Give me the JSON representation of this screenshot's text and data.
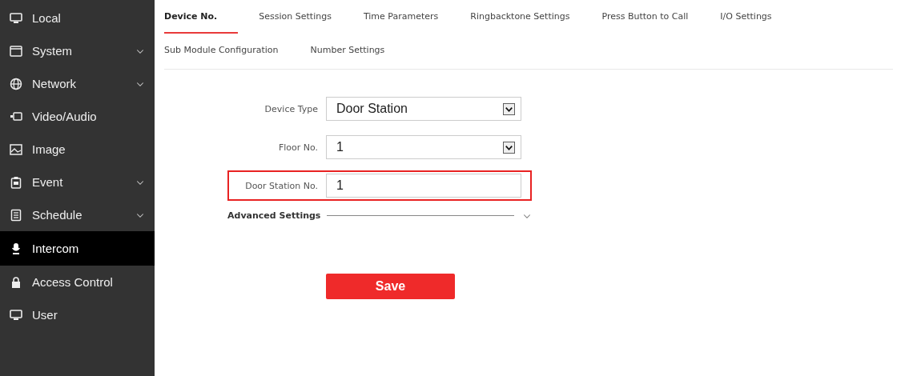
{
  "sidebar": {
    "items": [
      {
        "label": "Local",
        "expandable": false,
        "selected": false
      },
      {
        "label": "System",
        "expandable": true,
        "selected": false
      },
      {
        "label": "Network",
        "expandable": true,
        "selected": false
      },
      {
        "label": "Video/Audio",
        "expandable": false,
        "selected": false
      },
      {
        "label": "Image",
        "expandable": false,
        "selected": false
      },
      {
        "label": "Event",
        "expandable": true,
        "selected": false
      },
      {
        "label": "Schedule",
        "expandable": true,
        "selected": false
      },
      {
        "label": "Intercom",
        "expandable": false,
        "selected": true
      },
      {
        "label": "Access Control",
        "expandable": false,
        "selected": false
      },
      {
        "label": "User",
        "expandable": false,
        "selected": false
      }
    ]
  },
  "tabs": [
    {
      "label": "Device No.",
      "selected": true
    },
    {
      "label": "Session Settings",
      "selected": false
    },
    {
      "label": "Time Parameters",
      "selected": false
    },
    {
      "label": "Ringbacktone Settings",
      "selected": false
    },
    {
      "label": "Press Button to Call",
      "selected": false
    },
    {
      "label": "I/O Settings",
      "selected": false
    },
    {
      "label": "Sub Module Configuration",
      "selected": false
    },
    {
      "label": "Number Settings",
      "selected": false
    }
  ],
  "form": {
    "fields": [
      {
        "label": "Device Type",
        "kind": "select",
        "value": "Door Station",
        "highlighted": false
      },
      {
        "label": "Floor No.",
        "kind": "select",
        "value": "1",
        "highlighted": false
      },
      {
        "label": "Door Station No.",
        "kind": "text",
        "value": "1",
        "highlighted": true
      }
    ],
    "advanced": {
      "label": "Advanced Settings",
      "expanded": false
    },
    "save_button": "Save"
  }
}
